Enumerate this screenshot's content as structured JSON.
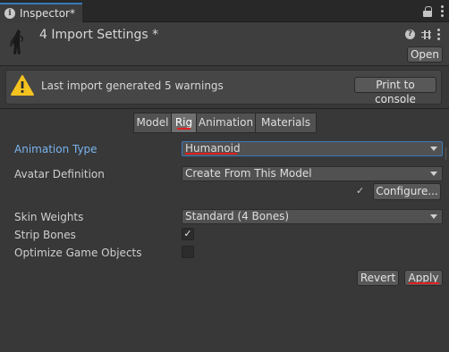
{
  "window": {
    "tab_label": "Inspector*"
  },
  "header": {
    "title": "4 Import Settings *",
    "open_label": "Open"
  },
  "warning": {
    "message": "Last import generated 5 warnings",
    "console_button": "Print to console"
  },
  "tabs": [
    {
      "label": "Model",
      "active": false
    },
    {
      "label": "Rig",
      "active": true
    },
    {
      "label": "Animation",
      "active": false
    },
    {
      "label": "Materials",
      "active": false
    }
  ],
  "rig": {
    "animation_type_label": "Animation Type",
    "animation_type_value": "Humanoid",
    "avatar_definition_label": "Avatar Definition",
    "avatar_definition_value": "Create From This Model",
    "configure_label": "Configure...",
    "skin_weights_label": "Skin Weights",
    "skin_weights_value": "Standard (4 Bones)",
    "strip_bones_label": "Strip Bones",
    "strip_bones_checked": true,
    "optimize_label": "Optimize Game Objects",
    "optimize_checked": false
  },
  "footer": {
    "revert_label": "Revert",
    "apply_label": "Apply"
  },
  "colors": {
    "background": "#383838",
    "accent_blue": "#3a79bb",
    "highlight_label": "#7ab4ee",
    "annotation_red": "#e02020",
    "warning_yellow": "#f4c21f"
  },
  "icons": [
    "info-icon",
    "lock-icon",
    "kebab-menu-icon",
    "help-icon",
    "preset-sliders-icon",
    "warning-icon",
    "checkmark-icon",
    "dropdown-arrow-icon"
  ]
}
